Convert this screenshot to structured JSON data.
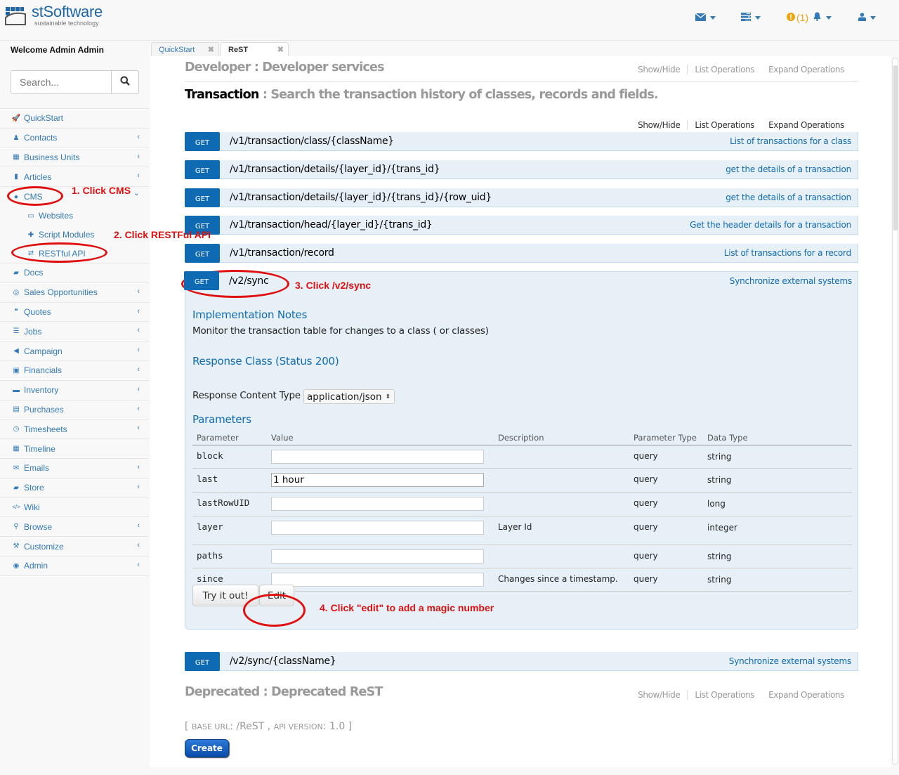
{
  "app": {
    "brand_name": "stSoftware",
    "brand_tagline": "sustainable technology",
    "notification_count": "(1)",
    "colors": {
      "brand": "#1f65a7",
      "link": "#337ab7",
      "get_method": "#0f6ab4",
      "warning": "#f0a30a",
      "annotation": "#e01010"
    }
  },
  "topbar": {
    "icons": [
      "envelope-icon",
      "tasks-icon",
      "exclamation-circle-icon",
      "bell-icon",
      "user-icon"
    ]
  },
  "sidebar": {
    "welcome": "Welcome Admin Admin",
    "search_placeholder": "Search...",
    "items": [
      {
        "label": "QuickStart",
        "icon": "rocket-icon",
        "has_arrow": false
      },
      {
        "label": "Contacts",
        "icon": "male-icon",
        "has_arrow": true
      },
      {
        "label": "Business Units",
        "icon": "building-icon",
        "has_arrow": true
      },
      {
        "label": "Articles",
        "icon": "file-icon",
        "has_arrow": true
      },
      {
        "label": "CMS",
        "icon": "globe-icon",
        "has_arrow": true,
        "expanded": true
      },
      {
        "label": "Websites",
        "icon": "desktop-icon",
        "sub": true
      },
      {
        "label": "Script Modules",
        "icon": "puzzle-icon",
        "sub": true
      },
      {
        "label": "RESTful API",
        "icon": "exchange-icon",
        "sub": true
      },
      {
        "label": "Docs",
        "icon": "folder-open-icon",
        "has_arrow": false
      },
      {
        "label": "Sales Opportunities",
        "icon": "bullseye-icon",
        "has_arrow": true
      },
      {
        "label": "Quotes",
        "icon": "quote-icon",
        "has_arrow": true
      },
      {
        "label": "Jobs",
        "icon": "tasks-icon",
        "has_arrow": true
      },
      {
        "label": "Campaign",
        "icon": "bullhorn-icon",
        "has_arrow": true
      },
      {
        "label": "Financials",
        "icon": "money-icon",
        "has_arrow": true
      },
      {
        "label": "Inventory",
        "icon": "archive-icon",
        "has_arrow": true
      },
      {
        "label": "Purchases",
        "icon": "credit-card-icon",
        "has_arrow": true
      },
      {
        "label": "Timesheets",
        "icon": "clock-icon",
        "has_arrow": true
      },
      {
        "label": "Timeline",
        "icon": "calendar-icon",
        "has_arrow": false
      },
      {
        "label": "Emails",
        "icon": "envelope-icon",
        "has_arrow": true
      },
      {
        "label": "Store",
        "icon": "truck-icon",
        "has_arrow": true
      },
      {
        "label": "Wiki",
        "icon": "code-icon",
        "has_arrow": false
      },
      {
        "label": "Browse",
        "icon": "search-icon",
        "has_arrow": true
      },
      {
        "label": "Customize",
        "icon": "wrench-icon",
        "has_arrow": true
      },
      {
        "label": "Admin",
        "icon": "dashboard-icon",
        "has_arrow": true
      }
    ]
  },
  "tabs": [
    {
      "label": "QuickStart",
      "active": false
    },
    {
      "label": "ReST",
      "active": true
    }
  ],
  "sections": {
    "developer": {
      "name": "Developer",
      "desc": "Developer services"
    },
    "transaction": {
      "name": "Transaction",
      "desc": "Search the transaction history of classes, records and fields."
    },
    "deprecated": {
      "name": "Deprecated",
      "desc": "Deprecated ReST"
    },
    "ops_labels": {
      "show_hide": "Show/Hide",
      "list": "List Operations",
      "expand": "Expand Operations"
    }
  },
  "operations": [
    {
      "method": "GET",
      "path": "/v1/transaction/class/{className}",
      "summary": "List of transactions for a class"
    },
    {
      "method": "GET",
      "path": "/v1/transaction/details/{layer_id}/{trans_id}",
      "summary": "get the details of a transaction"
    },
    {
      "method": "GET",
      "path": "/v1/transaction/details/{layer_id}/{trans_id}/{row_uid}",
      "summary": "get the details of a transaction"
    },
    {
      "method": "GET",
      "path": "/v1/transaction/head/{layer_id}/{trans_id}",
      "summary": "Get the header details for a transaction"
    },
    {
      "method": "GET",
      "path": "/v1/transaction/record",
      "summary": "List of transactions for a record"
    },
    {
      "method": "GET",
      "path": "/v2/sync",
      "summary": "Synchronize external systems"
    },
    {
      "method": "GET",
      "path": "/v2/sync/{className}",
      "summary": "Synchronize external systems"
    }
  ],
  "expanded_op": {
    "impl_notes_title": "Implementation Notes",
    "impl_notes": "Monitor the transaction table for changes to a class ( or classes)",
    "response_class": "Response Class (Status 200)",
    "content_type_label": "Response Content Type",
    "content_type_value": "application/json",
    "parameters_title": "Parameters",
    "param_headers": [
      "Parameter",
      "Value",
      "Description",
      "Parameter Type",
      "Data Type"
    ],
    "params": [
      {
        "name": "block",
        "value": "",
        "description": "",
        "param_type": "query",
        "data_type": "string"
      },
      {
        "name": "last",
        "value": "1 hour",
        "description": "",
        "param_type": "query",
        "data_type": "string"
      },
      {
        "name": "lastRowUID",
        "value": "",
        "description": "",
        "param_type": "query",
        "data_type": "long"
      },
      {
        "name": "layer",
        "value": "",
        "description": "Layer Id",
        "param_type": "query",
        "data_type": "integer"
      },
      {
        "name": "paths",
        "value": "",
        "description": "",
        "param_type": "query",
        "data_type": "string"
      },
      {
        "name": "since",
        "value": "",
        "description": "Changes since a timestamp.",
        "param_type": "query",
        "data_type": "string"
      }
    ],
    "try_label": "Try it out!",
    "edit_label": "Edit"
  },
  "footer": {
    "base_url_label": "BASE URL",
    "base_url": "/ReST",
    "api_version_label": "API VERSION",
    "api_version": "1.0",
    "create_label": "Create"
  },
  "annotations": [
    "1. Click CMS",
    "2. Click RESTFul API",
    "3. Click /v2/sync",
    "4. Click \"edit\" to add a magic number"
  ]
}
